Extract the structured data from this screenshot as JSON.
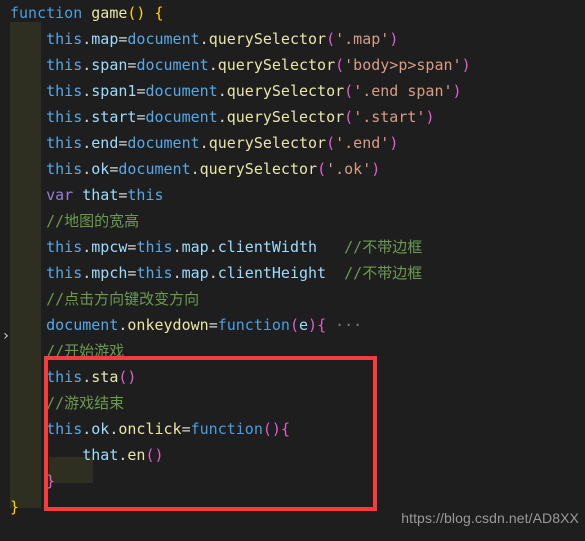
{
  "editor": {
    "theme_name": "dark",
    "background": "#1e1e1e",
    "indent_guide_color": "#2f2f21",
    "annotation_box_color": "#fb3b3b",
    "fold_chevron": "›",
    "fold_ellipsis": "···"
  },
  "code_lines": [
    {
      "id": "line-1",
      "tokens": [
        {
          "t": "function",
          "c": "kw"
        },
        {
          "t": " ",
          "c": "op"
        },
        {
          "t": "game",
          "c": "fn"
        },
        {
          "t": "()",
          "c": "ylw"
        },
        {
          "t": " ",
          "c": "op"
        },
        {
          "t": "{",
          "c": "ylw"
        }
      ]
    },
    {
      "id": "line-2",
      "tokens": [
        {
          "t": "    ",
          "c": "op"
        },
        {
          "t": "this",
          "c": "ident"
        },
        {
          "t": ".",
          "c": "op"
        },
        {
          "t": "map",
          "c": "prop"
        },
        {
          "t": "=",
          "c": "op"
        },
        {
          "t": "document",
          "c": "ident"
        },
        {
          "t": ".",
          "c": "op"
        },
        {
          "t": "querySelector",
          "c": "fn"
        },
        {
          "t": "(",
          "c": "mag"
        },
        {
          "t": "'.map'",
          "c": "str"
        },
        {
          "t": ")",
          "c": "mag"
        }
      ]
    },
    {
      "id": "line-3",
      "tokens": [
        {
          "t": "    ",
          "c": "op"
        },
        {
          "t": "this",
          "c": "ident"
        },
        {
          "t": ".",
          "c": "op"
        },
        {
          "t": "span",
          "c": "prop"
        },
        {
          "t": "=",
          "c": "op"
        },
        {
          "t": "document",
          "c": "ident"
        },
        {
          "t": ".",
          "c": "op"
        },
        {
          "t": "querySelector",
          "c": "fn"
        },
        {
          "t": "(",
          "c": "mag"
        },
        {
          "t": "'body>p>span'",
          "c": "str"
        },
        {
          "t": ")",
          "c": "mag"
        }
      ]
    },
    {
      "id": "line-4",
      "tokens": [
        {
          "t": "    ",
          "c": "op"
        },
        {
          "t": "this",
          "c": "ident"
        },
        {
          "t": ".",
          "c": "op"
        },
        {
          "t": "span1",
          "c": "prop"
        },
        {
          "t": "=",
          "c": "op"
        },
        {
          "t": "document",
          "c": "ident"
        },
        {
          "t": ".",
          "c": "op"
        },
        {
          "t": "querySelector",
          "c": "fn"
        },
        {
          "t": "(",
          "c": "mag"
        },
        {
          "t": "'.end span'",
          "c": "str"
        },
        {
          "t": ")",
          "c": "mag"
        }
      ]
    },
    {
      "id": "line-5",
      "tokens": [
        {
          "t": "    ",
          "c": "op"
        },
        {
          "t": "this",
          "c": "ident"
        },
        {
          "t": ".",
          "c": "op"
        },
        {
          "t": "start",
          "c": "prop"
        },
        {
          "t": "=",
          "c": "op"
        },
        {
          "t": "document",
          "c": "ident"
        },
        {
          "t": ".",
          "c": "op"
        },
        {
          "t": "querySelector",
          "c": "fn"
        },
        {
          "t": "(",
          "c": "mag"
        },
        {
          "t": "'.start'",
          "c": "str"
        },
        {
          "t": ")",
          "c": "mag"
        }
      ]
    },
    {
      "id": "line-6",
      "tokens": [
        {
          "t": "    ",
          "c": "op"
        },
        {
          "t": "this",
          "c": "ident"
        },
        {
          "t": ".",
          "c": "op"
        },
        {
          "t": "end",
          "c": "prop"
        },
        {
          "t": "=",
          "c": "op"
        },
        {
          "t": "document",
          "c": "ident"
        },
        {
          "t": ".",
          "c": "op"
        },
        {
          "t": "querySelector",
          "c": "fn"
        },
        {
          "t": "(",
          "c": "mag"
        },
        {
          "t": "'.end'",
          "c": "str"
        },
        {
          "t": ")",
          "c": "mag"
        }
      ]
    },
    {
      "id": "line-7",
      "tokens": [
        {
          "t": "    ",
          "c": "op"
        },
        {
          "t": "this",
          "c": "ident"
        },
        {
          "t": ".",
          "c": "op"
        },
        {
          "t": "ok",
          "c": "prop"
        },
        {
          "t": "=",
          "c": "op"
        },
        {
          "t": "document",
          "c": "ident"
        },
        {
          "t": ".",
          "c": "op"
        },
        {
          "t": "querySelector",
          "c": "fn"
        },
        {
          "t": "(",
          "c": "mag"
        },
        {
          "t": "'.ok'",
          "c": "str"
        },
        {
          "t": ")",
          "c": "mag"
        }
      ]
    },
    {
      "id": "line-8",
      "tokens": [
        {
          "t": "    ",
          "c": "op"
        },
        {
          "t": "var",
          "c": "kw2"
        },
        {
          "t": " ",
          "c": "op"
        },
        {
          "t": "that",
          "c": "prop"
        },
        {
          "t": "=",
          "c": "op"
        },
        {
          "t": "this",
          "c": "ident"
        }
      ]
    },
    {
      "id": "line-9",
      "tokens": [
        {
          "t": "    ",
          "c": "op"
        },
        {
          "t": "//地图的宽高",
          "c": "cmt"
        }
      ]
    },
    {
      "id": "line-10",
      "tokens": [
        {
          "t": "    ",
          "c": "op"
        },
        {
          "t": "this",
          "c": "ident"
        },
        {
          "t": ".",
          "c": "op"
        },
        {
          "t": "mpcw",
          "c": "prop"
        },
        {
          "t": "=",
          "c": "op"
        },
        {
          "t": "this",
          "c": "ident"
        },
        {
          "t": ".",
          "c": "op"
        },
        {
          "t": "map",
          "c": "prop"
        },
        {
          "t": ".",
          "c": "op"
        },
        {
          "t": "clientWidth",
          "c": "prop"
        },
        {
          "t": "   ",
          "c": "op"
        },
        {
          "t": "//不带边框",
          "c": "cmt"
        }
      ]
    },
    {
      "id": "line-11",
      "tokens": [
        {
          "t": "    ",
          "c": "op"
        },
        {
          "t": "this",
          "c": "ident"
        },
        {
          "t": ".",
          "c": "op"
        },
        {
          "t": "mpch",
          "c": "prop"
        },
        {
          "t": "=",
          "c": "op"
        },
        {
          "t": "this",
          "c": "ident"
        },
        {
          "t": ".",
          "c": "op"
        },
        {
          "t": "map",
          "c": "prop"
        },
        {
          "t": ".",
          "c": "op"
        },
        {
          "t": "clientHeight",
          "c": "prop"
        },
        {
          "t": "  ",
          "c": "op"
        },
        {
          "t": "//不带边框",
          "c": "cmt"
        }
      ]
    },
    {
      "id": "line-12",
      "tokens": [
        {
          "t": "    ",
          "c": "op"
        },
        {
          "t": "//点击方向键改变方向",
          "c": "cmt"
        }
      ]
    },
    {
      "id": "line-13",
      "tokens": [
        {
          "t": "    ",
          "c": "op"
        },
        {
          "t": "document",
          "c": "ident"
        },
        {
          "t": ".",
          "c": "op"
        },
        {
          "t": "onkeydown",
          "c": "fn"
        },
        {
          "t": "=",
          "c": "op"
        },
        {
          "t": "function",
          "c": "kw"
        },
        {
          "t": "(",
          "c": "mag"
        },
        {
          "t": "e",
          "c": "prop"
        },
        {
          "t": ")",
          "c": "mag"
        },
        {
          "t": "{",
          "c": "mag"
        },
        {
          "t": " ",
          "c": "op"
        },
        {
          "t": "···",
          "c": "fold"
        }
      ]
    },
    {
      "id": "line-14",
      "tokens": [
        {
          "t": "    ",
          "c": "op"
        },
        {
          "t": "//开始游戏",
          "c": "cmt"
        }
      ]
    },
    {
      "id": "line-15",
      "tokens": [
        {
          "t": "    ",
          "c": "op"
        },
        {
          "t": "this",
          "c": "ident"
        },
        {
          "t": ".",
          "c": "op"
        },
        {
          "t": "sta",
          "c": "fn"
        },
        {
          "t": "()",
          "c": "mag"
        }
      ]
    },
    {
      "id": "line-16",
      "tokens": [
        {
          "t": "    ",
          "c": "op"
        },
        {
          "t": "//游戏结束",
          "c": "cmt"
        }
      ]
    },
    {
      "id": "line-17",
      "tokens": [
        {
          "t": "    ",
          "c": "op"
        },
        {
          "t": "this",
          "c": "ident"
        },
        {
          "t": ".",
          "c": "op"
        },
        {
          "t": "ok",
          "c": "prop"
        },
        {
          "t": ".",
          "c": "op"
        },
        {
          "t": "onclick",
          "c": "fn"
        },
        {
          "t": "=",
          "c": "op"
        },
        {
          "t": "function",
          "c": "kw"
        },
        {
          "t": "(",
          "c": "mag"
        },
        {
          "t": ")",
          "c": "mag"
        },
        {
          "t": "{",
          "c": "mag"
        }
      ]
    },
    {
      "id": "line-18",
      "tokens": [
        {
          "t": "        ",
          "c": "op"
        },
        {
          "t": "that",
          "c": "prop"
        },
        {
          "t": ".",
          "c": "op"
        },
        {
          "t": "en",
          "c": "fn"
        },
        {
          "t": "()",
          "c": "mag"
        }
      ]
    },
    {
      "id": "line-19",
      "tokens": [
        {
          "t": "    ",
          "c": "op"
        },
        {
          "t": "}",
          "c": "mag"
        }
      ]
    },
    {
      "id": "line-20",
      "tokens": [
        {
          "t": "}",
          "c": "ylw"
        }
      ]
    }
  ],
  "watermark": {
    "text": "https://blog.csdn.net/AD8XX"
  }
}
